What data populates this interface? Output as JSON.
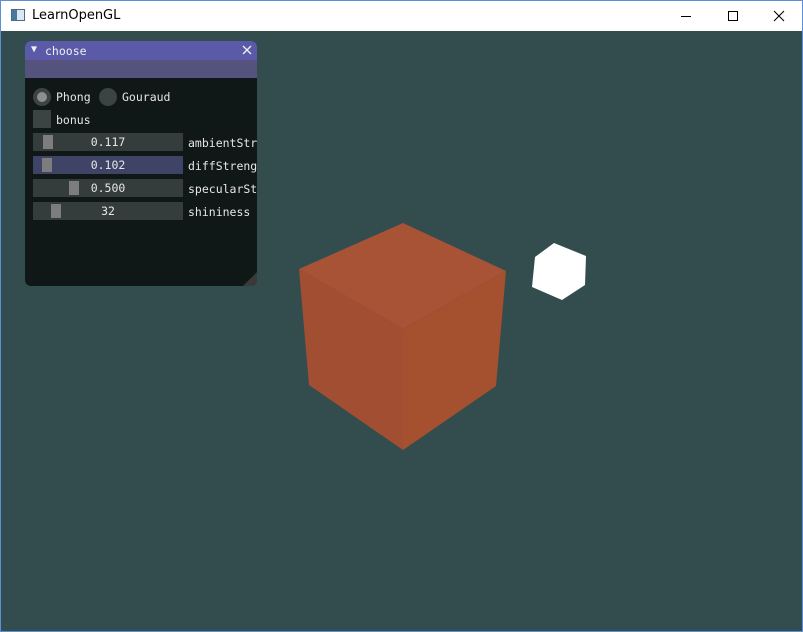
{
  "window": {
    "title": "LearnOpenGL",
    "app_icon": "window-app-icon",
    "controls": [
      "minimize-icon",
      "maximize-icon",
      "close-icon"
    ]
  },
  "panel": {
    "title": "choose",
    "collapse_icon": "triangle-down-icon",
    "close_icon": "close-icon",
    "title_color": "#5b5aa8",
    "shading": {
      "options": [
        {
          "label": "Phong",
          "selected": true
        },
        {
          "label": "Gouraud",
          "selected": false
        }
      ]
    },
    "bonus": {
      "label": "bonus",
      "checked": false
    },
    "sliders": [
      {
        "value": "0.117",
        "label": "ambientStr",
        "grab_fraction": 0.117
      },
      {
        "value": "0.102",
        "label": "diffStreng",
        "grab_fraction": 0.102
      },
      {
        "value": "0.500",
        "label": "specularSt",
        "grab_fraction": 0.5
      },
      {
        "value": "32",
        "label": "shininess",
        "grab_fraction": 0.12
      }
    ]
  },
  "scene": {
    "background_color": "#334d4e",
    "object_cube_color": "#a84f34",
    "light_cube_color": "#ffffff"
  }
}
